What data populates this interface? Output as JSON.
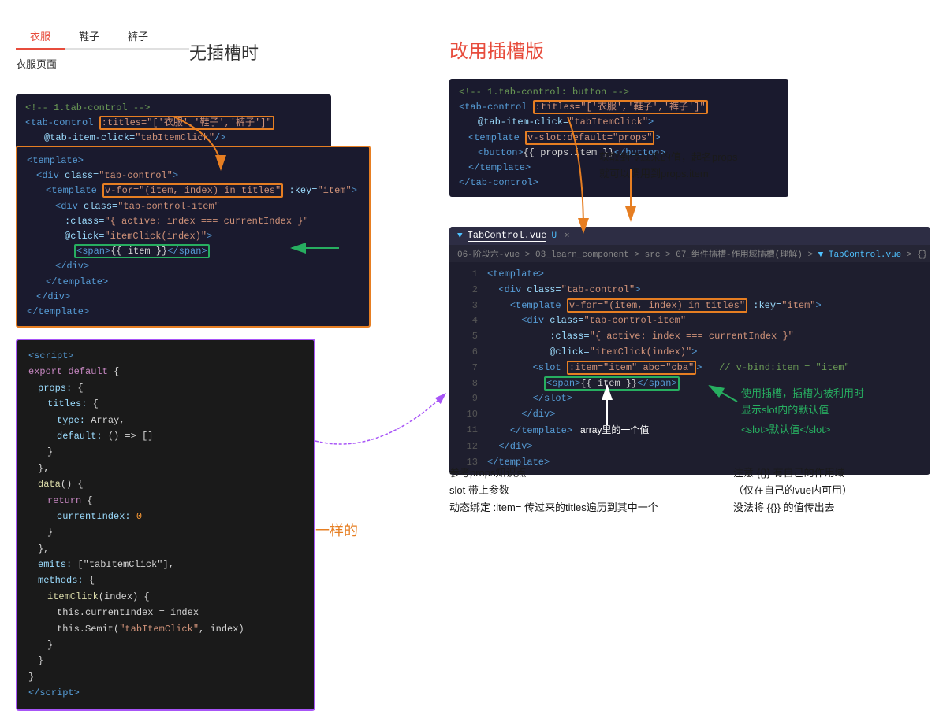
{
  "tabs": {
    "items": [
      "衣服",
      "鞋子",
      "裤子"
    ],
    "active_index": 0,
    "page_label": "衣服页面"
  },
  "section_no_slot": {
    "title": "无插槽时"
  },
  "section_slot": {
    "title": "改用插槽版"
  },
  "top_code_no_slot": {
    "comment": "<!-- 1.tab-control -->",
    "line1": "<tab-control ",
    "titles_attr": ":titles=\"['衣服','鞋子','裤子']\"",
    "line2": "           @tab-item-click=\"tabItemClick\"/>"
  },
  "top_code_slot": {
    "comment": "<!-- 1.tab-control: button -->",
    "line1": "<tab-control ",
    "titles_attr": ":titles=\"['衣服','鞋子','裤子']\"",
    "line2": "         @tab-item-click=\"tabItemClick\">",
    "line3": "  <template ",
    "slot_attr": "v-slot:default=\"props\">",
    "line4": "    <button>{{ props.item }}</button>",
    "line5": "  </template>",
    "line6": "</tab-control>"
  },
  "template_code": {
    "lines": [
      "<template>",
      "  <div class=\"tab-control\">",
      "    <template v-for=\"(item, index) in titles\" :key=\"item\">",
      "      <div class=\"tab-control-item\"",
      "           :class=\"{ active: index === currentIndex }\"",
      "           @click=\"itemClick(index)\">",
      "        <span>{{ item }}</span>",
      "      </div>",
      "    </template>",
      "  </div>",
      "</template>"
    ]
  },
  "script_code": {
    "lines": [
      "<script>",
      "export default {",
      "  props: {",
      "    titles: {",
      "      type: Array,",
      "      default: () => []",
      "    }",
      "  },",
      "  data() {",
      "    return {",
      "      currentIndex: 0",
      "    }",
      "  },",
      "  emits: [\"tabItemClick\"],",
      "  methods: {",
      "    itemClick(index) {",
      "      this.currentIndex = index",
      "      this.$emit(\"tabItemClick\", index)",
      "    }",
      "  }",
      "}",
      "</script>"
    ]
  },
  "vscode_editor": {
    "title": "TabControl.vue",
    "modifier": "U",
    "close_icon": "×",
    "breadcrumb": "06-阶段六-vue > 03_learn_component > src > 07_组件插槽-作用域插槽(理解) > ▼ TabControl.vue > {}",
    "lines": [
      {
        "num": "1",
        "content": "  <template>"
      },
      {
        "num": "2",
        "content": "    <div class=\"tab-control\">"
      },
      {
        "num": "3",
        "content": "      <template v-for=\"(item, index) in titles\" :key=\"item\">"
      },
      {
        "num": "4",
        "content": "        <div class=\"tab-control-item\""
      },
      {
        "num": "5",
        "content": "             :class=\"{ active: index === currentIndex }\""
      },
      {
        "num": "6",
        "content": "             @click=\"itemClick(index)\">"
      },
      {
        "num": "7",
        "content": "          <slot :item=\"item\" abc=\"cba\">    // v-bind:item = \"item\""
      },
      {
        "num": "8",
        "content": "            <span>{{ item }}</span>"
      },
      {
        "num": "9",
        "content": "          </slot>"
      },
      {
        "num": "10",
        "content": "        </div>"
      },
      {
        "num": "11",
        "content": "      </template>"
      },
      {
        "num": "12",
        "content": "    </div>"
      },
      {
        "num": "13",
        "content": "  </template>"
      }
    ]
  },
  "annotations": {
    "same_label": "一样的",
    "annotation1_title": "获取到传过来的值，起名props",
    "annotation1_body": "就可以调用到props.item",
    "annotation2_title": "使用插槽，插槽为被利用时",
    "annotation2_body": "显示slot内的默认值",
    "annotation3": "<slot>默认值</slot>",
    "annotation4_title": "参考props知识点",
    "annotation4_body": "slot 带上参数\n动态绑定 :item= 传过来的titles遍历到其中一个",
    "annotation5_title": "注意 {{}} 有自己的作用域",
    "annotation5_body": "（仅在自己的vue内可用）\n没法将 {{}} 的值传出去",
    "array_item_label": "array里的一个值"
  }
}
